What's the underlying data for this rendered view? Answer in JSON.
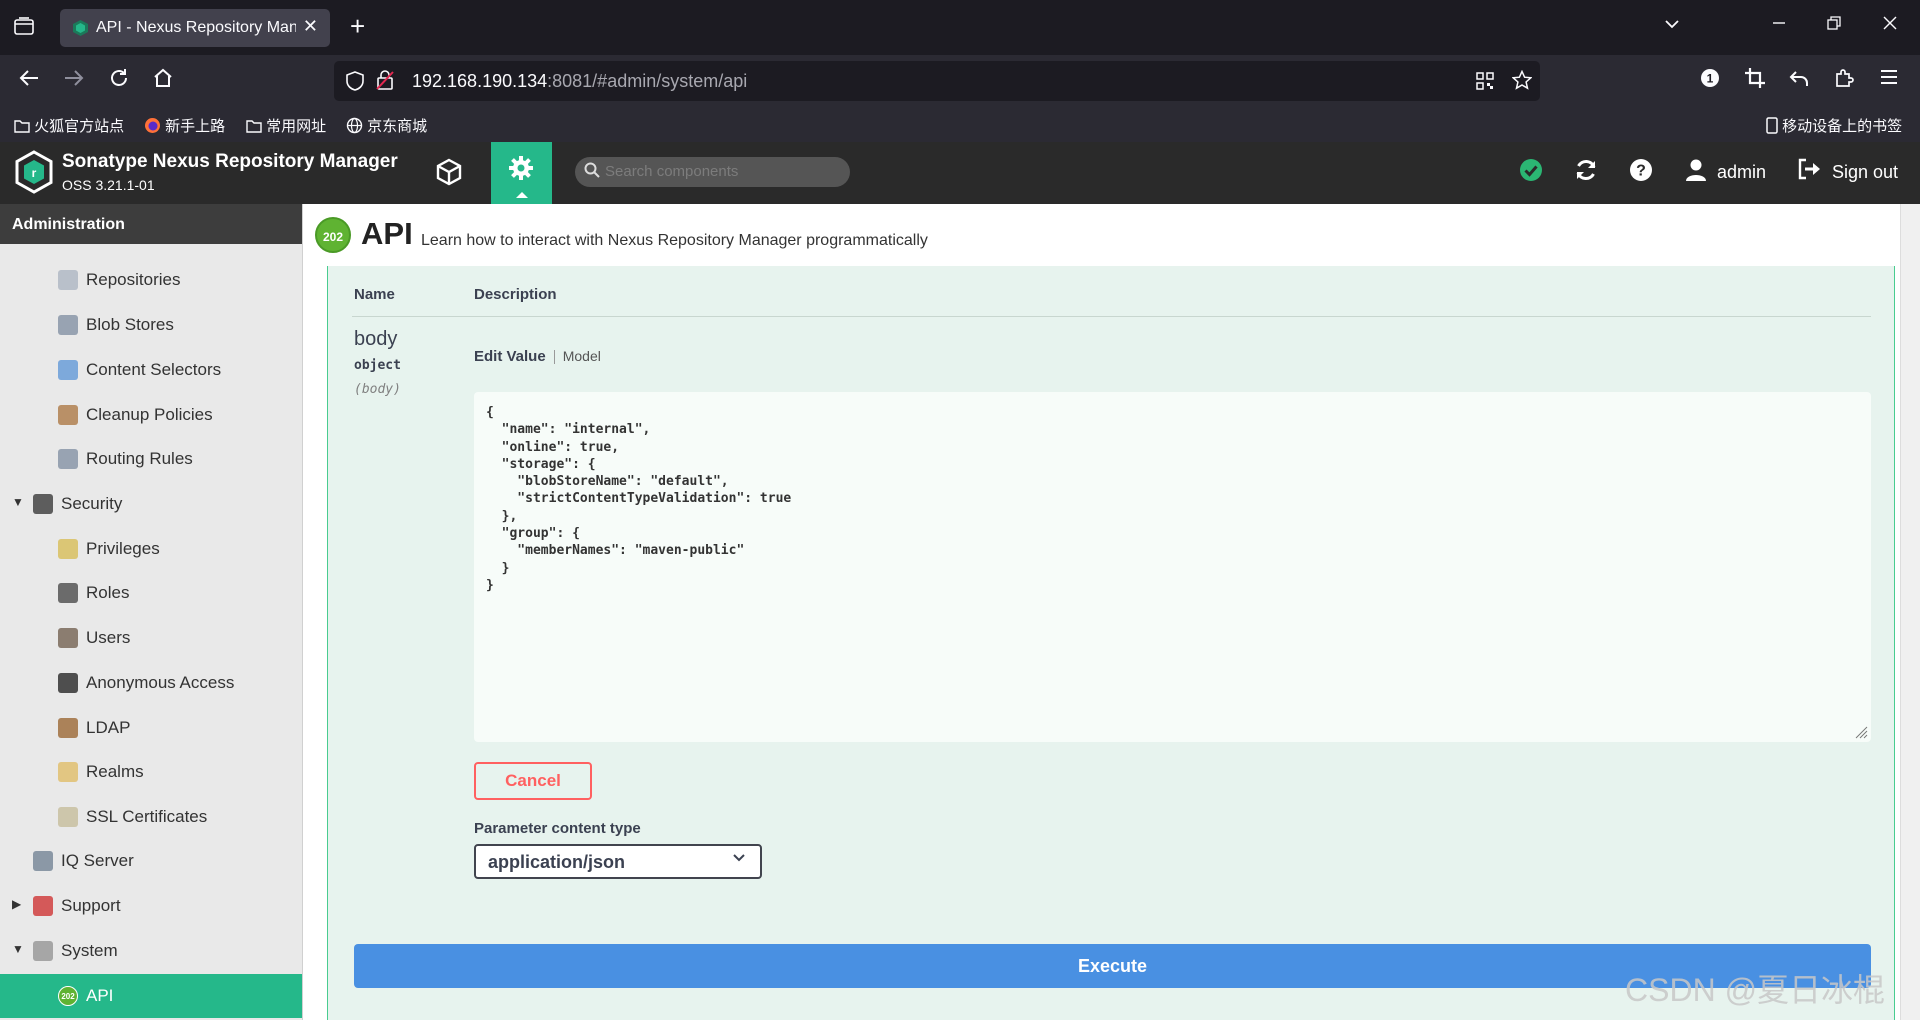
{
  "browser": {
    "tab_title": "API - Nexus Repository Mana",
    "tab_close": "✕",
    "new_tab": "+",
    "url_host": "192.168.190.134",
    "url_rest": ":8081/#admin/system/api",
    "bookmarks": [
      "火狐官方站点",
      "新手上路",
      "常用网址",
      "京东商城"
    ],
    "mobile_bookmarks": "移动设备上的书签"
  },
  "app": {
    "brand": "Sonatype Nexus Repository Manager",
    "version": "OSS 3.21.1-01",
    "search_placeholder": "Search components",
    "user": "admin",
    "sign_out": "Sign out"
  },
  "sidebar": {
    "title": "Administration",
    "items": [
      {
        "label": "Repositories",
        "icon": "database-icon",
        "color": "#b0b8c4"
      },
      {
        "label": "Blob Stores",
        "icon": "server-icon",
        "color": "#8a96a8"
      },
      {
        "label": "Content Selectors",
        "icon": "selector-icon",
        "color": "#6a9ed8"
      },
      {
        "label": "Cleanup Policies",
        "icon": "broom-icon",
        "color": "#b08050"
      },
      {
        "label": "Routing Rules",
        "icon": "route-icon",
        "color": "#8a96a8"
      },
      {
        "label": "Security",
        "icon": "security-icon",
        "color": "#444444"
      },
      {
        "label": "Privileges",
        "icon": "medal-icon",
        "color": "#d8c060"
      },
      {
        "label": "Roles",
        "icon": "role-icon",
        "color": "#555555"
      },
      {
        "label": "Users",
        "icon": "users-icon",
        "color": "#7a6a5a"
      },
      {
        "label": "Anonymous Access",
        "icon": "id-card-icon",
        "color": "#333333"
      },
      {
        "label": "LDAP",
        "icon": "book-icon",
        "color": "#a07040"
      },
      {
        "label": "Realms",
        "icon": "shield-icon",
        "color": "#e0c070"
      },
      {
        "label": "SSL Certificates",
        "icon": "certificate-icon",
        "color": "#c8c0a0"
      },
      {
        "label": "IQ Server",
        "icon": "iq-icon",
        "color": "#7a8a9a"
      },
      {
        "label": "Support",
        "icon": "lifebuoy-icon",
        "color": "#d04040"
      },
      {
        "label": "System",
        "icon": "gear-icon",
        "color": "#9a9a9a"
      },
      {
        "label": "API",
        "icon": "api-202-icon",
        "color": "#5fb332"
      }
    ]
  },
  "page": {
    "badge": "202",
    "title": "API",
    "subtitle": "Learn how to interact with Nexus Repository Manager programmatically"
  },
  "params": {
    "col_name": "Name",
    "col_desc": "Description",
    "param_name": "body",
    "param_type": "object",
    "param_in": "(body)",
    "tab_edit": "Edit Value",
    "tab_model": "Model",
    "body_value": "{\n  \"name\": \"internal\",\n  \"online\": true,\n  \"storage\": {\n    \"blobStoreName\": \"default\",\n    \"strictContentTypeValidation\": true\n  },\n  \"group\": {\n    \"memberNames\": \"maven-public\"\n  }\n}",
    "cancel": "Cancel",
    "content_type_label": "Parameter content type",
    "content_type_value": "application/json",
    "execute": "Execute"
  },
  "watermark": "CSDN @夏日冰棍",
  "colors": {
    "accent": "#25b88a",
    "execute": "#4990e2",
    "cancel": "#ff6060",
    "op_bg": "#e7f3ee"
  }
}
